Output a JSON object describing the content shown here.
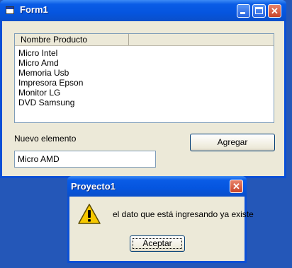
{
  "form": {
    "title": "Form1",
    "list_header": "Nombre Producto",
    "items": [
      "Micro Intel",
      "Micro Amd",
      "Memoria Usb",
      "Impresora Epson",
      "Monitor LG",
      "DVD Samsung"
    ],
    "new_label": "Nuevo elemento",
    "new_value": "Micro AMD",
    "add_button": "Agregar",
    "min_glyph": "_",
    "close_glyph": "✕"
  },
  "dialog": {
    "title": "Proyecto1",
    "message": "el dato que está ingresando ya existe",
    "ok_button": "Aceptar",
    "close_glyph": "✕",
    "icon": "warning-icon"
  },
  "colors": {
    "desktop": "#2457b8",
    "titlebar": "#0555df",
    "window_bg": "#ece9d8"
  }
}
